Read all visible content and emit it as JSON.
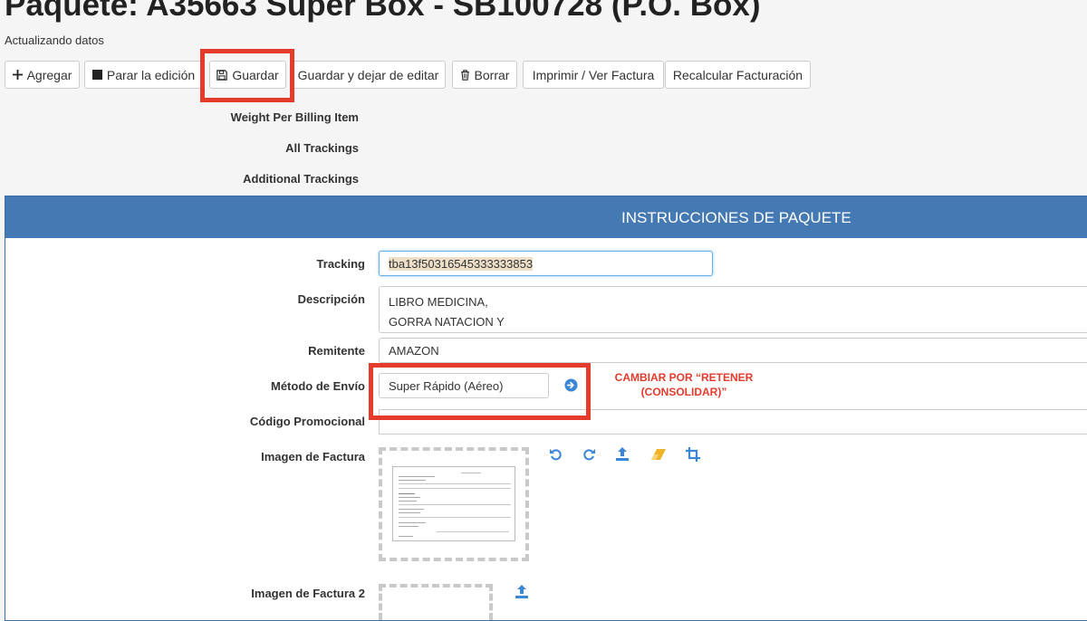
{
  "page": {
    "title": "Paquete: A35663 Super Box - SB100728 (P.O. Box)",
    "subtitle": "Actualizando datos"
  },
  "toolbar": {
    "add_label": "Agregar",
    "stop_label": "Parar la edición",
    "save_label": "Guardar",
    "save_stop_label": "Guardar y dejar de editar",
    "delete_label": "Borrar",
    "print_label": "Imprimir / Ver Factura",
    "recalc_label": "Recalcular Facturación"
  },
  "info": {
    "weight_label": "Weight Per Billing Item",
    "all_trackings_label": "All Trackings",
    "additional_trackings_label": "Additional Trackings"
  },
  "panel": {
    "title": "INSTRUCCIONES DE PAQUETE",
    "tracking_label": "Tracking",
    "tracking_value": "tba13f50316545333333853",
    "description_label": "Descripción",
    "description_value": "LIBRO MEDICINA,\nGORRA NATACION Y",
    "sender_label": "Remitente",
    "sender_value": "AMAZON",
    "shipping_label": "Método de Envío",
    "shipping_value": "Super Rápido (Aéreo)",
    "promo_label": "Código Promocional",
    "promo_value": "",
    "invoice_label": "Imagen de Factura",
    "invoice2_label": "Imagen de Factura 2"
  },
  "annotation": {
    "line1": "CAMBIAR POR “RETENER",
    "line2": "(CONSOLIDAR)”"
  },
  "colors": {
    "accent_blue": "#4479b3",
    "highlight_red": "#e53b2c",
    "icon_blue": "#3b86d6",
    "eraser_orange": "#f0b429"
  },
  "icons": [
    "plus-icon",
    "stop-icon",
    "floppy-disk-icon",
    "trash-icon",
    "arrow-right-circle-icon",
    "rotate-left-icon",
    "rotate-right-icon",
    "upload-icon",
    "eraser-icon",
    "crop-icon"
  ]
}
